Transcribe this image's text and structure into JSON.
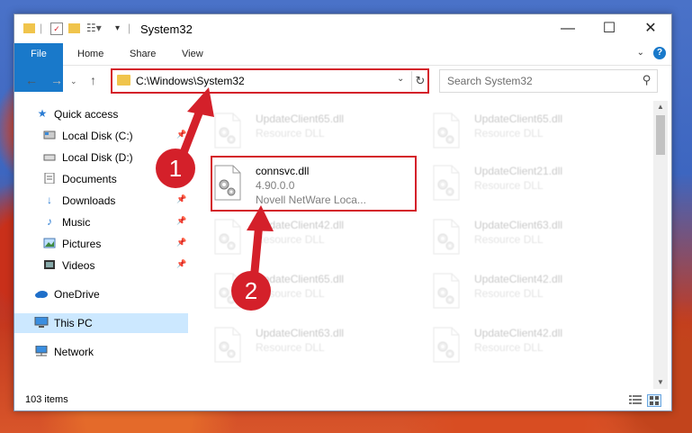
{
  "window": {
    "title": "System32"
  },
  "ribbon": {
    "tabs": [
      "File",
      "Home",
      "Share",
      "View"
    ]
  },
  "address": {
    "path": "C:\\Windows\\System32"
  },
  "search": {
    "placeholder": "Search System32"
  },
  "sidebar": {
    "items": [
      {
        "label": "Quick access",
        "icon": "star-icon"
      },
      {
        "label": "Local Disk (C:)",
        "icon": "drive-icon"
      },
      {
        "label": "Local Disk (D:)",
        "icon": "drive-icon"
      },
      {
        "label": "Documents",
        "icon": "documents-icon"
      },
      {
        "label": "Downloads",
        "icon": "downloads-icon"
      },
      {
        "label": "Music",
        "icon": "music-icon"
      },
      {
        "label": "Pictures",
        "icon": "pictures-icon"
      },
      {
        "label": "Videos",
        "icon": "videos-icon"
      },
      {
        "label": "OneDrive",
        "icon": "cloud-icon"
      },
      {
        "label": "This PC",
        "icon": "computer-icon",
        "selected": true
      },
      {
        "label": "Network",
        "icon": "network-icon"
      }
    ]
  },
  "files": [
    {
      "name": "UpdateClient65.dll",
      "type": "Resource DLL",
      "faded": true
    },
    {
      "name": "UpdateClient65.dll",
      "type": "Resource DLL",
      "faded": true
    },
    {
      "name": "connsvc.dll",
      "type": "4.90.0.0",
      "desc": "Novell NetWare Loca...",
      "faded": false
    },
    {
      "name": "UpdateClient21.dll",
      "type": "Resource DLL",
      "faded": true
    },
    {
      "name": "UpdateClient42.dll",
      "type": "Resource DLL",
      "faded": true
    },
    {
      "name": "UpdateClient63.dll",
      "type": "Resource DLL",
      "faded": true
    },
    {
      "name": "UpdateClient65.dll",
      "type": "Resource DLL",
      "faded": true
    },
    {
      "name": "UpdateClient42.dll",
      "type": "Resource DLL",
      "faded": true
    },
    {
      "name": "UpdateClient63.dll",
      "type": "Resource DLL",
      "faded": true
    },
    {
      "name": "UpdateClient42.dll",
      "type": "Resource DLL",
      "faded": true
    }
  ],
  "status": {
    "count": "103 items"
  },
  "annotations": {
    "step1": "1",
    "step2": "2"
  },
  "colors": {
    "highlight": "#d4202a",
    "accent": "#1979ca",
    "selection": "#cce8ff"
  }
}
